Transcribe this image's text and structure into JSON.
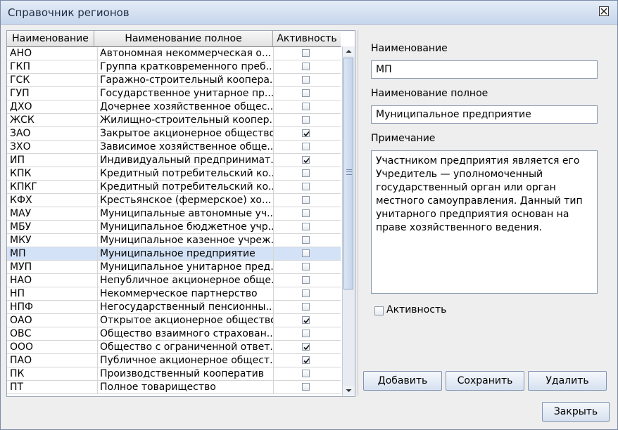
{
  "window": {
    "title": "Справочник регионов"
  },
  "table": {
    "headers": {
      "code": "Наименование",
      "full": "Наименование полное",
      "active": "Активность"
    },
    "rows": [
      {
        "code": "АНО",
        "full": "Автономная некоммерческая о...",
        "active": false
      },
      {
        "code": "ГКП",
        "full": "Группа кратковременного преб...",
        "active": false
      },
      {
        "code": "ГСК",
        "full": "Гаражно-строительный коопера...",
        "active": false
      },
      {
        "code": "ГУП",
        "full": "Государственное унитарное пр...",
        "active": false
      },
      {
        "code": "ДХО",
        "full": "Дочернее хозяйственное общес...",
        "active": false
      },
      {
        "code": "ЖСК",
        "full": "Жилищно-строительный коопер...",
        "active": false
      },
      {
        "code": "ЗАО",
        "full": "Закрытое акционерное общество",
        "active": true
      },
      {
        "code": "ЗХО",
        "full": "Зависимое хозяйственное обще...",
        "active": false
      },
      {
        "code": "ИП",
        "full": "Индивидуальный предпринимат...",
        "active": true
      },
      {
        "code": "КПК",
        "full": "Кредитный потребительский ко...",
        "active": false
      },
      {
        "code": "КПКГ",
        "full": "Кредитный потребительский ко...",
        "active": false
      },
      {
        "code": "КФХ",
        "full": "Крестьянское (фермерское) хо...",
        "active": false
      },
      {
        "code": "МАУ",
        "full": "Муниципальные автономные уч...",
        "active": false
      },
      {
        "code": "МБУ",
        "full": "Муниципальное бюджетное учр...",
        "active": false
      },
      {
        "code": "МКУ",
        "full": "Муниципальное казенное учреж...",
        "active": false
      },
      {
        "code": "МП",
        "full": "Муниципальное предприятие",
        "active": false,
        "selected": true
      },
      {
        "code": "МУП",
        "full": "Муниципальное унитарное пред...",
        "active": false
      },
      {
        "code": "НАО",
        "full": "Непубличное акционерное обще...",
        "active": false
      },
      {
        "code": "НП",
        "full": "Некоммерческое партнерство",
        "active": false
      },
      {
        "code": "НПФ",
        "full": "Негосударственный пенсионны...",
        "active": false
      },
      {
        "code": "ОАО",
        "full": "Открытое акционерное общество",
        "active": true
      },
      {
        "code": "ОВС",
        "full": "Общество взаимного страхован...",
        "active": false
      },
      {
        "code": "ООО",
        "full": "Общество с ограниченной ответ...",
        "active": true
      },
      {
        "code": "ПАО",
        "full": "Публичное акционерное общест...",
        "active": true
      },
      {
        "code": "ПК",
        "full": "Производственный кооператив",
        "active": false
      },
      {
        "code": "ПТ",
        "full": "Полное товарищество",
        "active": false
      }
    ]
  },
  "details": {
    "name_label": "Наименование",
    "name_value": "МП",
    "full_label": "Наименование полное",
    "full_value": "Муниципальное предприятие",
    "note_label": "Примечание",
    "note_value": "Участником предприятия является его Учредитель — уполномоченный государственный орган или орган местного самоуправления. Данный тип унитарного предприятия основан на праве хозяйственного ведения.",
    "active_label": "Активность",
    "active_checked": false
  },
  "buttons": {
    "add": "Добавить",
    "save": "Сохранить",
    "delete": "Удалить",
    "close": "Закрыть"
  },
  "icons": {
    "close": "close-icon",
    "check": "checkmark-icon",
    "scroll_up": "arrow-up-icon",
    "scroll_down": "arrow-down-icon"
  }
}
